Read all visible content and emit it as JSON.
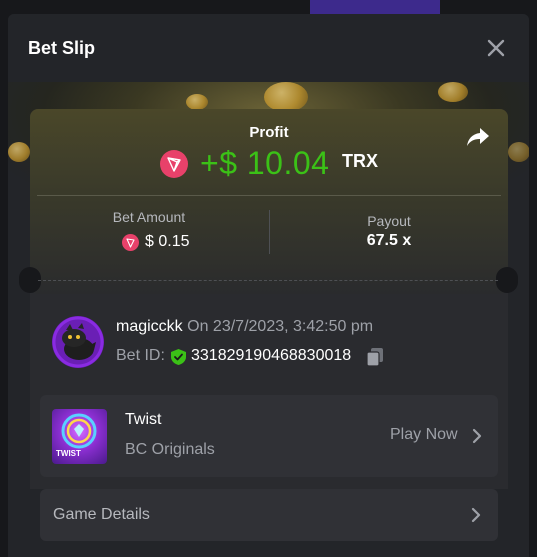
{
  "modal": {
    "title": "Bet Slip"
  },
  "profit": {
    "label": "Profit",
    "value": "+$ 10.04",
    "currency": "TRX"
  },
  "stats": {
    "bet_amount_label": "Bet Amount",
    "bet_amount_value": "$ 0.15",
    "payout_label": "Payout",
    "payout_value": "67.5 x"
  },
  "user": {
    "name": "magicckk",
    "date": "On 23/7/2023, 3:42:50 pm",
    "bet_id_label": "Bet ID:",
    "bet_id": "331829190468830018"
  },
  "game": {
    "name": "Twist",
    "provider": "BC Originals",
    "play_label": "Play Now",
    "thumb_text": "TWIST"
  },
  "details": {
    "label": "Game Details"
  },
  "colors": {
    "profit": "#3bc117",
    "tron": "#e8416a",
    "verified": "#3bc117",
    "modal_bg": "#232529"
  },
  "icons": {
    "close": "close-icon",
    "share": "share-arrow-icon",
    "tron": "tron-icon",
    "verified": "shield-check-icon",
    "copy": "copy-icon",
    "chevron": "chevron-right-icon"
  }
}
